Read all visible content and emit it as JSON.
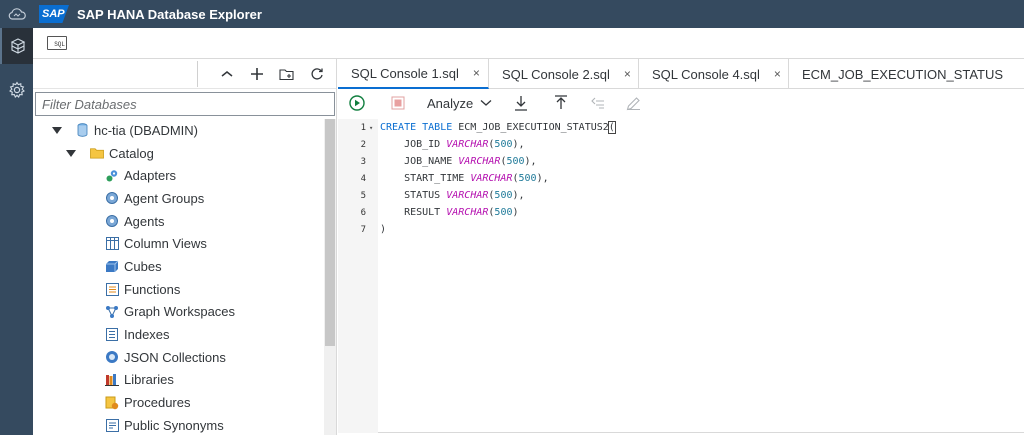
{
  "shell": {
    "logo_text": "SAP",
    "title": "SAP HANA Database Explorer"
  },
  "sidebar_icons": [
    "cloud-icon",
    "database-icon",
    "settings-icon"
  ],
  "toolbar": {
    "sql_label": "SQL"
  },
  "db_panel": {
    "filter_placeholder": "Filter Databases",
    "tools": [
      "collapse-all",
      "add",
      "add-folder",
      "refresh"
    ],
    "tree": [
      {
        "label": "hc-tia (DBADMIN)",
        "level": 0,
        "icon": "database-icon",
        "expanded": true
      },
      {
        "label": "Catalog",
        "level": 1,
        "icon": "folder-icon",
        "expanded": true
      },
      {
        "label": "Adapters",
        "level": 2,
        "icon": "adapter-icon"
      },
      {
        "label": "Agent Groups",
        "level": 2,
        "icon": "agent-group-icon"
      },
      {
        "label": "Agents",
        "level": 2,
        "icon": "agent-icon"
      },
      {
        "label": "Column Views",
        "level": 2,
        "icon": "column-view-icon"
      },
      {
        "label": "Cubes",
        "level": 2,
        "icon": "cube-icon"
      },
      {
        "label": "Functions",
        "level": 2,
        "icon": "function-icon"
      },
      {
        "label": "Graph Workspaces",
        "level": 2,
        "icon": "graph-icon"
      },
      {
        "label": "Indexes",
        "level": 2,
        "icon": "index-icon"
      },
      {
        "label": "JSON Collections",
        "level": 2,
        "icon": "json-icon"
      },
      {
        "label": "Libraries",
        "level": 2,
        "icon": "library-icon"
      },
      {
        "label": "Procedures",
        "level": 2,
        "icon": "procedure-icon"
      },
      {
        "label": "Public Synonyms",
        "level": 2,
        "icon": "synonym-icon"
      }
    ]
  },
  "editor": {
    "tabs": [
      {
        "label": "SQL Console 1.sql",
        "active": true,
        "closable": true
      },
      {
        "label": "SQL Console 2.sql",
        "active": false,
        "closable": true
      },
      {
        "label": "SQL Console 4.sql",
        "active": false,
        "closable": true
      },
      {
        "label": "ECM_JOB_EXECUTION_STATUS",
        "active": false,
        "closable": false
      }
    ],
    "close_glyph": "×",
    "analyze_label": "Analyze",
    "code_lines": [
      {
        "n": "1",
        "fold": true,
        "tokens": [
          [
            "kw",
            "CREATE TABLE"
          ],
          [
            "pl",
            " ECM_JOB_EXECUTION_STATUS2"
          ],
          [
            "cur",
            "("
          ]
        ]
      },
      {
        "n": "2",
        "tokens": [
          [
            "pl",
            "    JOB_ID "
          ],
          [
            "ty",
            "VARCHAR"
          ],
          [
            "pl",
            "("
          ],
          [
            "nu",
            "500"
          ],
          [
            "pl",
            "),"
          ]
        ]
      },
      {
        "n": "3",
        "tokens": [
          [
            "pl",
            "    JOB_NAME "
          ],
          [
            "ty",
            "VARCHAR"
          ],
          [
            "pl",
            "("
          ],
          [
            "nu",
            "500"
          ],
          [
            "pl",
            "),"
          ]
        ]
      },
      {
        "n": "4",
        "tokens": [
          [
            "pl",
            "    START_TIME "
          ],
          [
            "ty",
            "VARCHAR"
          ],
          [
            "pl",
            "("
          ],
          [
            "nu",
            "500"
          ],
          [
            "pl",
            "),"
          ]
        ]
      },
      {
        "n": "5",
        "tokens": [
          [
            "pl",
            "    STATUS "
          ],
          [
            "ty",
            "VARCHAR"
          ],
          [
            "pl",
            "("
          ],
          [
            "nu",
            "500"
          ],
          [
            "pl",
            "),"
          ]
        ]
      },
      {
        "n": "6",
        "tokens": [
          [
            "pl",
            "    RESULT "
          ],
          [
            "ty",
            "VARCHAR"
          ],
          [
            "pl",
            "("
          ],
          [
            "nu",
            "500"
          ],
          [
            "pl",
            ")"
          ]
        ]
      },
      {
        "n": "7",
        "tokens": [
          [
            "pl",
            ")"
          ]
        ]
      }
    ]
  },
  "colors": {
    "shell": "#354a5f",
    "accent": "#0a6ed1",
    "run_green": "#107e3e",
    "stop_red": "#bb0000"
  }
}
